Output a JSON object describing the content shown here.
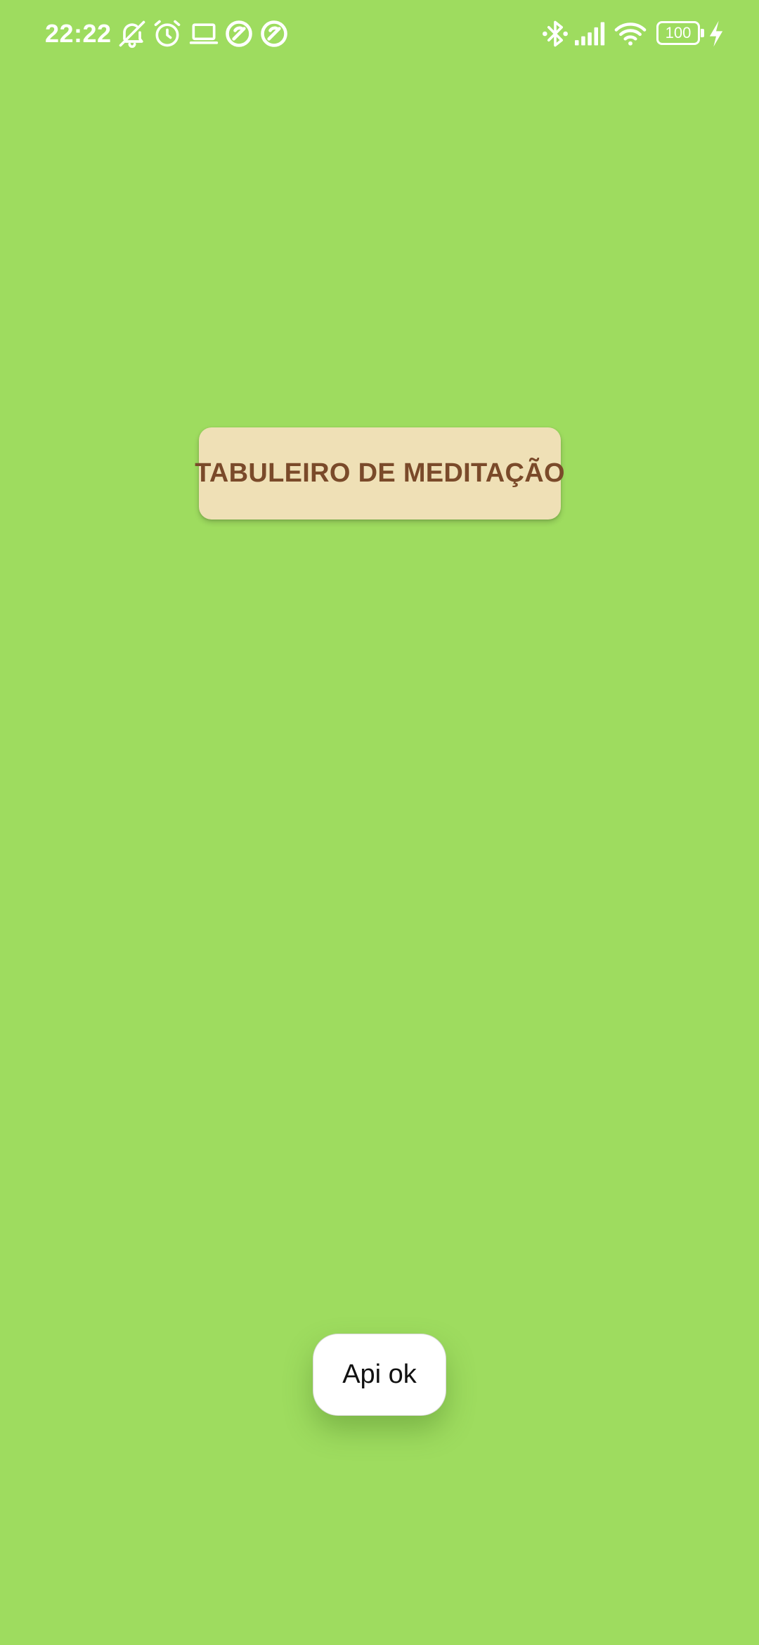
{
  "status_bar": {
    "time": "22:22",
    "battery_level": "100",
    "left_icons": [
      "bell-off-icon",
      "alarm-icon",
      "laptop-icon",
      "app-circle-icon",
      "app-circle-icon"
    ],
    "right_icons": [
      "bluetooth-icon",
      "signal-icon",
      "wifi-icon",
      "battery-icon",
      "charging-icon"
    ]
  },
  "main": {
    "title_button_label": "TABULEIRO DE MEDITAÇÃO"
  },
  "toast": {
    "message": "Api ok"
  },
  "colors": {
    "background": "#9edc5f",
    "button_background": "#efe0b6",
    "button_text": "#7a4a2a",
    "toast_background": "#ffffff"
  }
}
